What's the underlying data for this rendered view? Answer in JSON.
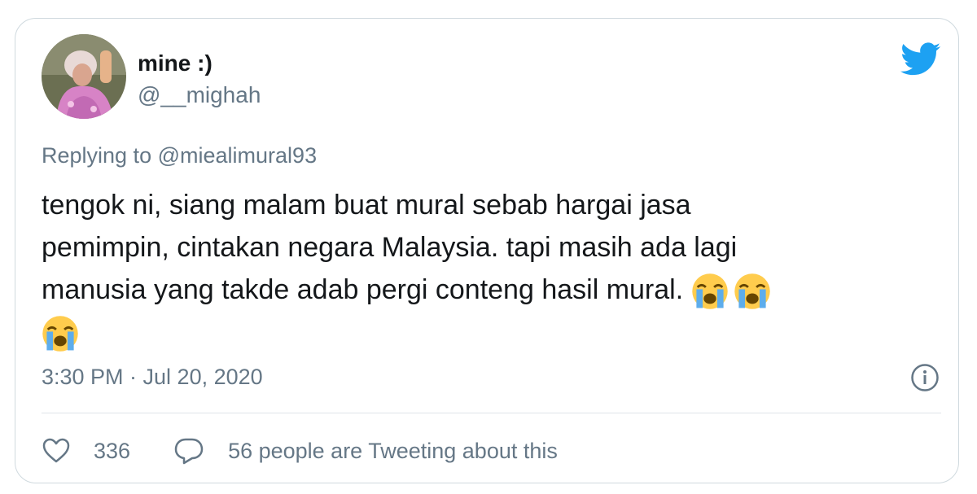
{
  "tweet": {
    "display_name": "mine :)",
    "handle": "@__mighah",
    "replying_label": "Replying to",
    "replying_to": "@miealimural93",
    "text_lines": [
      "tengok ni, siang malam buat mural sebab hargai jasa",
      "pemimpin, cintakan negara Malaysia. tapi masih ada lagi",
      "manusia yang takde adab pergi conteng hasil mural."
    ],
    "emojis": [
      "loudly-crying-face",
      "loudly-crying-face",
      "loudly-crying-face"
    ],
    "timestamp": "3:30 PM · Jul 20, 2020",
    "like_count": "336",
    "tweeting_text": "56 people are Tweeting about this"
  },
  "colors": {
    "text": "#14171a",
    "secondary": "#657786",
    "twitter_blue": "#1da1f2",
    "border": "#cfd9de"
  }
}
